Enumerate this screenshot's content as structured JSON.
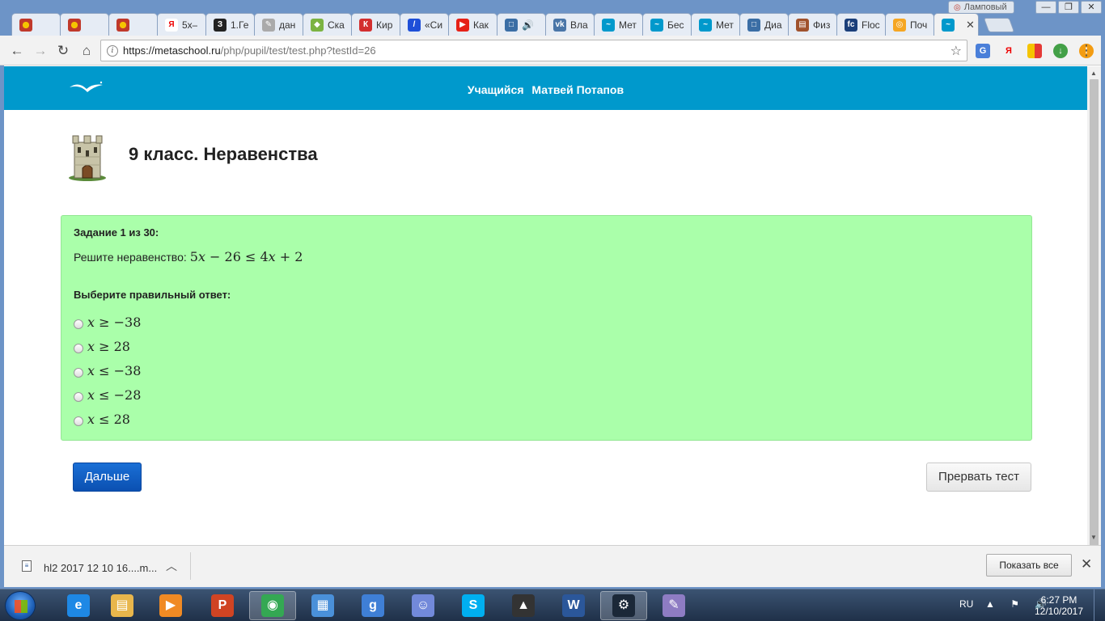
{
  "window": {
    "badge": "Ламповый",
    "controls": [
      "—",
      "❐",
      "✕"
    ]
  },
  "tabs": [
    {
      "title": "",
      "icon_color": "#c0392b",
      "icon": "gerb"
    },
    {
      "title": "",
      "icon_color": "#c0392b",
      "icon": "gerb"
    },
    {
      "title": "",
      "icon_color": "#c0392b",
      "icon": "gerb"
    },
    {
      "title": "5x–",
      "icon_color": "#ffffff",
      "icon": "Я"
    },
    {
      "title": "1.Ге",
      "icon_color": "#222222",
      "icon": "З"
    },
    {
      "title": "дан",
      "icon_color": "#aaaaaa",
      "icon": "✎"
    },
    {
      "title": "Ска",
      "icon_color": "#7cb342",
      "icon": "◆"
    },
    {
      "title": "Кир",
      "icon_color": "#d32f2f",
      "icon": "К"
    },
    {
      "title": "«Си",
      "icon_color": "#1e4fd8",
      "icon": "/"
    },
    {
      "title": "Как",
      "icon_color": "#e62117",
      "icon": "▶"
    },
    {
      "title": "🔊",
      "icon_color": "#3b6ea5",
      "icon": "□"
    },
    {
      "title": "Вла",
      "icon_color": "#4a76a8",
      "icon": "vk"
    },
    {
      "title": "Мет",
      "icon_color": "#0099cc",
      "icon": "~"
    },
    {
      "title": "Бес",
      "icon_color": "#0099cc",
      "icon": "~"
    },
    {
      "title": "Мет",
      "icon_color": "#0099cc",
      "icon": "~"
    },
    {
      "title": "Диа",
      "icon_color": "#3b6ea5",
      "icon": "□"
    },
    {
      "title": "Физ",
      "icon_color": "#a0522d",
      "icon": "▤"
    },
    {
      "title": "Floc",
      "icon_color": "#1b3f7a",
      "icon": "fc"
    },
    {
      "title": "Поч",
      "icon_color": "#f5a623",
      "icon": "◎"
    },
    {
      "title": "",
      "icon_color": "#0099cc",
      "icon": "~",
      "active": true
    }
  ],
  "toolbar": {
    "url_host": "https://metaschool.ru",
    "url_rest": "/php/pupil/test/test.php?testId=26"
  },
  "header": {
    "role": "Учащийся",
    "user": "Матвей Потапов"
  },
  "page": {
    "title": "9 класс. Неравенства"
  },
  "task": {
    "number_label": "Задание 1 из 30:",
    "question_prefix": "Решите неравенство:",
    "question_math": {
      "a": "5",
      "v": "x",
      "op1": " − 26 ≤ 4",
      "v2": "x",
      "tail": " + 2"
    },
    "choose_label": "Выберите правильный ответ:",
    "options": [
      {
        "rel": " ≥ −38"
      },
      {
        "rel": " ≥ 28"
      },
      {
        "rel": " ≤ −38"
      },
      {
        "rel": " ≤ −28"
      },
      {
        "rel": " ≤ 28"
      }
    ]
  },
  "buttons": {
    "next": "Дальше",
    "stop": "Прервать тест"
  },
  "downloads": {
    "file": "hl2 2017 12 10 16....m...",
    "show_all": "Показать все"
  },
  "taskbar": {
    "lang": "RU",
    "time": "6:27 PM",
    "date": "12/10/2017"
  }
}
